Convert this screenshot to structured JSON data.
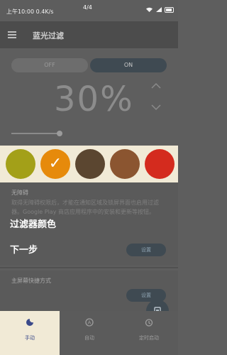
{
  "status": {
    "time": "上午10:00",
    "net_speed": "0.4K/s",
    "page_counter": "4/4",
    "icons": [
      "wifi-icon",
      "signal-icon",
      "battery-icon"
    ]
  },
  "app": {
    "title": "蓝光过滤",
    "menu_icon": "menu-icon"
  },
  "toggle": {
    "off": "OFF",
    "on": "ON"
  },
  "intensity": {
    "value": "30%",
    "up_icon": "chevron-up-icon",
    "down_icon": "chevron-down-icon"
  },
  "slider": {
    "level_percent": 30
  },
  "palette": {
    "colors": [
      "#a3a018",
      "#e68a0b",
      "#5b4630",
      "#8b5530",
      "#d42b1e"
    ],
    "selected_index": 1
  },
  "card1": {
    "title": "无障碍",
    "body": "取得无障碍权限后，才能在通知区域及锁屏界面也启用过滤器。Google Play 商店应用程序中的安装和更新等按钮。",
    "button": "设置"
  },
  "card2": {
    "title": "主屏幕快捷方式",
    "button": "设置"
  },
  "guide": {
    "title": "过滤器颜色",
    "next": "下一步"
  },
  "fab_icon": "power-icon",
  "nav": [
    {
      "label": "手动",
      "icon": "moon-icon",
      "active": true
    },
    {
      "label": "自动",
      "icon": "auto-icon",
      "active": false
    },
    {
      "label": "定时启动",
      "icon": "alarm-icon",
      "active": false
    }
  ],
  "colors": {
    "palette_bg": "#f1ead6",
    "accent": "#3b4a8a",
    "overlay": "#5e5e5e"
  }
}
